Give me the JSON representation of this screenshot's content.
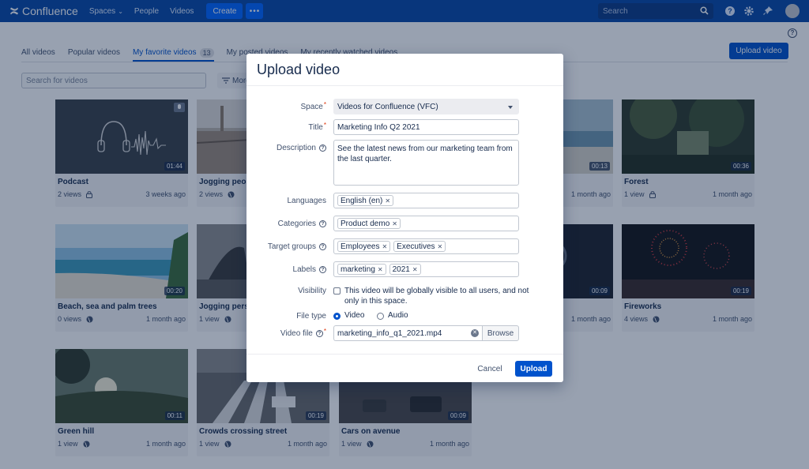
{
  "topnav": {
    "brand": "Confluence",
    "items": [
      {
        "label": "Spaces",
        "dropdown": true
      },
      {
        "label": "People"
      },
      {
        "label": "Videos"
      }
    ],
    "create_label": "Create",
    "more_label": "•••",
    "search_placeholder": "Search",
    "colors": {
      "bar": "#0747a6",
      "create": "#0065ff"
    }
  },
  "page": {
    "tabs": [
      {
        "label": "All videos"
      },
      {
        "label": "Popular videos"
      },
      {
        "label": "My favorite videos",
        "badge": "13",
        "active": true
      },
      {
        "label": "My posted videos"
      },
      {
        "label": "My recently watched videos"
      }
    ],
    "upload_label": "Upload video",
    "search_placeholder": "Search for videos",
    "more_filter_label": "More"
  },
  "videos": [
    {
      "title": "Podcast",
      "views": "2 views",
      "visibility": "lock-icon",
      "date": "3 weeks ago",
      "duration": "01:44"
    },
    {
      "title": "Jogging people",
      "views": "2 views",
      "visibility": "globe-icon",
      "date": "",
      "duration": ""
    },
    {
      "title": "",
      "views": "",
      "visibility": "",
      "date": "1 month ago",
      "duration": "00:13"
    },
    {
      "title": "Forest",
      "views": "1 view",
      "visibility": "lock-icon",
      "date": "1 month ago",
      "duration": "00:36"
    },
    {
      "title": "Beach, sea and palm trees",
      "views": "0 views",
      "visibility": "globe-icon",
      "date": "1 month ago",
      "duration": "00:20"
    },
    {
      "title": "Jogging persons",
      "views": "1 view",
      "visibility": "globe-icon",
      "date": "",
      "duration": ""
    },
    {
      "title": "",
      "views": "",
      "visibility": "",
      "date": "1 month ago",
      "duration": "00:09"
    },
    {
      "title": "Fireworks",
      "views": "4 views",
      "visibility": "globe-icon",
      "date": "1 month ago",
      "duration": "00:19"
    },
    {
      "title": "Green hill",
      "views": "1 view",
      "visibility": "globe-icon",
      "date": "1 month ago",
      "duration": "00:11"
    },
    {
      "title": "Crowds crossing street",
      "views": "1 view",
      "visibility": "globe-icon",
      "date": "1 month ago",
      "duration": "00:19"
    },
    {
      "title": "Cars on avenue",
      "views": "1 view",
      "visibility": "globe-icon",
      "date": "1 month ago",
      "duration": "00:09"
    }
  ],
  "modal": {
    "title": "Upload video",
    "space": {
      "label": "Space",
      "value": "Videos for Confluence (VFC)"
    },
    "title_field": {
      "label": "Title",
      "value": "Marketing Info Q2 2021"
    },
    "description": {
      "label": "Description",
      "value": "See the latest news from our marketing team from the last quarter."
    },
    "languages": {
      "label": "Languages",
      "chips": [
        "English (en)"
      ]
    },
    "categories": {
      "label": "Categories",
      "chips": [
        "Product demo"
      ]
    },
    "target_groups": {
      "label": "Target groups",
      "chips": [
        "Employees",
        "Executives"
      ]
    },
    "labels": {
      "label": "Labels",
      "chips": [
        "marketing",
        "2021"
      ]
    },
    "visibility": {
      "label": "Visibility",
      "text": "This video will be globally visible to all users, and not only in this space.",
      "checked": false
    },
    "file_type": {
      "label": "File type",
      "options": [
        "Video",
        "Audio"
      ],
      "selected": "Video"
    },
    "video_file": {
      "label": "Video file",
      "value": "marketing_info_q1_2021.mp4",
      "browse_label": "Browse"
    },
    "cancel_label": "Cancel",
    "submit_label": "Upload",
    "colors": {
      "primary": "#0052cc",
      "required": "#de350b"
    }
  }
}
